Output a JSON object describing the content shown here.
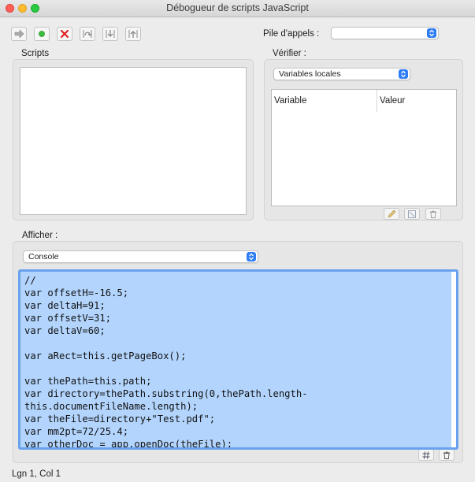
{
  "window": {
    "title": "Débogueur de scripts JavaScript"
  },
  "toolbar": {
    "buttons": [
      {
        "name": "continue-button",
        "icon": "arrow-right-icon"
      },
      {
        "name": "step-button",
        "icon": "green-dot-icon"
      },
      {
        "name": "stop-button",
        "icon": "red-x-icon"
      },
      {
        "name": "step-over-button",
        "icon": "step-over-icon"
      },
      {
        "name": "step-into-button",
        "icon": "step-into-icon"
      },
      {
        "name": "step-out-button",
        "icon": "step-out-icon"
      }
    ]
  },
  "callstack": {
    "label": "Pile d'appels :",
    "value": ""
  },
  "scripts": {
    "label": "Scripts"
  },
  "inspect": {
    "label": "Vérifier :",
    "select_value": "Variables locales",
    "columns": [
      "Variable",
      "Valeur"
    ]
  },
  "view": {
    "label": "Afficher :",
    "select_value": "Console",
    "code": "//\nvar offsetH=-16.5;\nvar deltaH=91;\nvar offsetV=31;\nvar deltaV=60;\n\nvar aRect=this.getPageBox();\n\nvar thePath=this.path;\nvar directory=thePath.substring(0,thePath.length-\nthis.documentFileName.length);\nvar theFile=directory+\"Test.pdf\";\nvar mm2pt=72/25.4;\nvar otherDoc = app.openDoc(theFile);"
  },
  "status": {
    "position": "Lgn 1, Col 1"
  },
  "colors": {
    "selection": "#b3d5fd",
    "focus_ring": "#6aa1ee",
    "accent": "#2e7cf6"
  }
}
